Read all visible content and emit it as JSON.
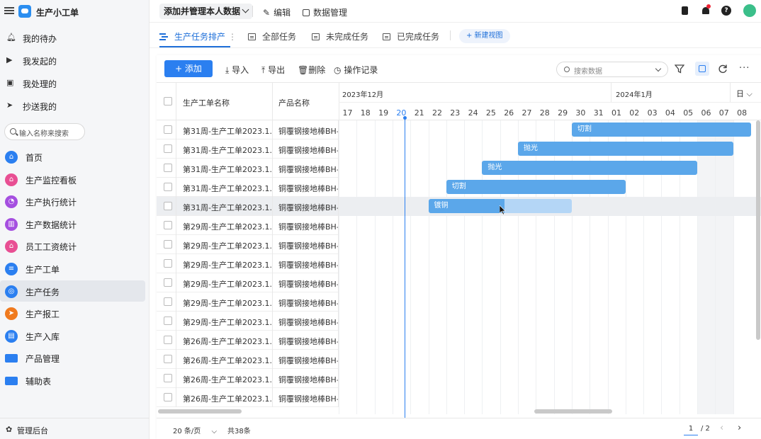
{
  "app": {
    "title": "生产小工单"
  },
  "sidebar": {
    "top_items": [
      {
        "label": "我的待办",
        "icon": "bell-icon"
      },
      {
        "label": "我发起的",
        "icon": "play-icon"
      },
      {
        "label": "我处理的",
        "icon": "inbox-icon"
      },
      {
        "label": "抄送我的",
        "icon": "send-icon"
      }
    ],
    "search_placeholder": "输入名称来搜索",
    "nav_items": [
      {
        "label": "首页",
        "icon": "home-icon",
        "color": "#2b7ff0"
      },
      {
        "label": "生产监控看板",
        "icon": "home-icon",
        "color": "#e84f93"
      },
      {
        "label": "生产执行统计",
        "icon": "pie-chart-icon",
        "color": "#a54fe0"
      },
      {
        "label": "生产数据统计",
        "icon": "bar-chart-icon",
        "color": "#a54fe0"
      },
      {
        "label": "员工工资统计",
        "icon": "house-icon",
        "color": "#e84f93"
      },
      {
        "label": "生产工单",
        "icon": "list-icon",
        "color": "#2b7ff0"
      },
      {
        "label": "生产任务",
        "icon": "target-icon",
        "color": "#2b7ff0",
        "active": true
      },
      {
        "label": "生产报工",
        "icon": "arrow-icon",
        "color": "#f07a1e"
      },
      {
        "label": "生产入库",
        "icon": "clipboard-icon",
        "color": "#2b7ff0"
      },
      {
        "label": "产品管理",
        "icon": "folder-icon",
        "color": "#2b7ff0"
      },
      {
        "label": "辅助表",
        "icon": "folder-icon",
        "color": "#2b7ff0"
      }
    ],
    "footer_label": "管理后台"
  },
  "topbar": {
    "dropdown_label": "添加并管理本人数据",
    "edit_label": "编辑",
    "data_manage_label": "数据管理"
  },
  "tabs": [
    {
      "label": "生产任务排产",
      "active": true
    },
    {
      "label": "全部任务"
    },
    {
      "label": "未完成任务"
    },
    {
      "label": "已完成任务"
    }
  ],
  "new_view_label": "+ 新建视图",
  "toolbar": {
    "add_label": "+ 添加",
    "import_label": "导入",
    "export_label": "导出",
    "delete_label": "删除",
    "log_label": "操作记录",
    "search_placeholder": "搜索数据"
  },
  "grid": {
    "col_name": "生产工单名称",
    "col_product": "产品名称",
    "month1": "2023年12月",
    "month2": "2024年1月",
    "scale": "日",
    "days": [
      "17",
      "18",
      "19",
      "20",
      "21",
      "22",
      "23",
      "24",
      "25",
      "26",
      "27",
      "28",
      "29",
      "30",
      "31",
      "01",
      "02",
      "03",
      "04",
      "05",
      "06",
      "07",
      "08"
    ],
    "today": "20",
    "rows": [
      {
        "name": "第31周-生产工单2023.1...",
        "product": "铜覆钢接地棒BH-G"
      },
      {
        "name": "第31周-生产工单2023.1...",
        "product": "铜覆钢接地棒BH-G"
      },
      {
        "name": "第31周-生产工单2023.1...",
        "product": "铜覆钢接地棒BH-G"
      },
      {
        "name": "第31周-生产工单2023.1...",
        "product": "铜覆钢接地棒BH-G"
      },
      {
        "name": "第31周-生产工单2023.1...",
        "product": "铜覆钢接地棒BH-G"
      },
      {
        "name": "第29周-生产工单2023.1...",
        "product": "铜覆钢接地棒BH-G"
      },
      {
        "name": "第29周-生产工单2023.1...",
        "product": "铜覆钢接地棒BH-G"
      },
      {
        "name": "第29周-生产工单2023.1...",
        "product": "铜覆钢接地棒BH-G"
      },
      {
        "name": "第29周-生产工单2023.1...",
        "product": "铜覆钢接地棒BH-G"
      },
      {
        "name": "第29周-生产工单2023.1...",
        "product": "铜覆钢接地棒BH-G"
      },
      {
        "name": "第29周-生产工单2023.1...",
        "product": "铜覆钢接地棒BH-G"
      },
      {
        "name": "第26周-生产工单2023.1...",
        "product": "铜覆钢接地棒BH-G"
      },
      {
        "name": "第26周-生产工单2023.1...",
        "product": "铜覆钢接地棒BH-G"
      },
      {
        "name": "第26周-生产工单2023.1...",
        "product": "铜覆钢接地棒BH-G"
      },
      {
        "name": "第26周-生产工单2023.1...",
        "product": "铜覆钢接地棒BH-G"
      }
    ],
    "bars": [
      {
        "row": 0,
        "label": "切割",
        "start": "30",
        "end": "08"
      },
      {
        "row": 1,
        "label": "抛光",
        "start": "27",
        "end": "07"
      },
      {
        "row": 2,
        "label": "抛光",
        "start": "25",
        "end": "05"
      },
      {
        "row": 3,
        "label": "切割",
        "start": "23",
        "end": "01"
      },
      {
        "row": 4,
        "label": "镀铜",
        "start": "22",
        "end": "29",
        "progress": 0.53
      }
    ]
  },
  "footer": {
    "page_size": "20 条/页",
    "total": "共38条",
    "page": "1",
    "pages": "/ 2"
  }
}
